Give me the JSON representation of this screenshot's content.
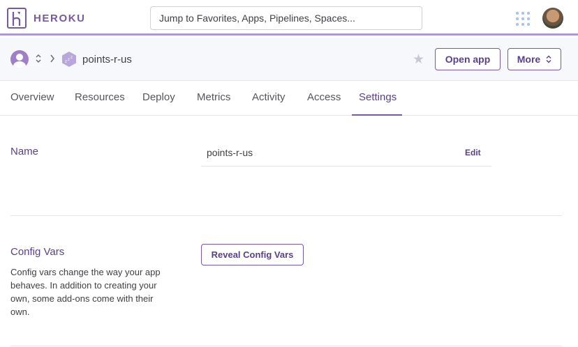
{
  "header": {
    "brand": "HEROKU",
    "search_placeholder": "Jump to Favorites, Apps, Pipelines, Spaces..."
  },
  "app_header": {
    "app_name": "points-r-us",
    "open_app_label": "Open app",
    "more_label": "More"
  },
  "tabs": [
    {
      "label": "Overview"
    },
    {
      "label": "Resources"
    },
    {
      "label": "Deploy"
    },
    {
      "label": "Metrics"
    },
    {
      "label": "Activity"
    },
    {
      "label": "Access"
    },
    {
      "label": "Settings",
      "active": true
    }
  ],
  "name_section": {
    "title": "Name",
    "value": "points-r-us",
    "edit_label": "Edit"
  },
  "config_section": {
    "title": "Config Vars",
    "description": "Config vars change the way your app behaves. In addition to creating your own, some add-ons come with their own.",
    "reveal_label": "Reveal Config Vars"
  },
  "icons": {
    "logo": "heroku-logo-icon",
    "apps": "apps-grid-icon",
    "team": "user-avatar-icon",
    "switcher": "up-down-chevron-icon",
    "breadcrumb": "chevron-right-icon",
    "app": "sleeping-app-hexagon-icon",
    "favorite": "star-icon"
  },
  "colors": {
    "brand_purple": "#79589f",
    "accent_bar": "#a99ad6",
    "text": "#3f3f44"
  }
}
